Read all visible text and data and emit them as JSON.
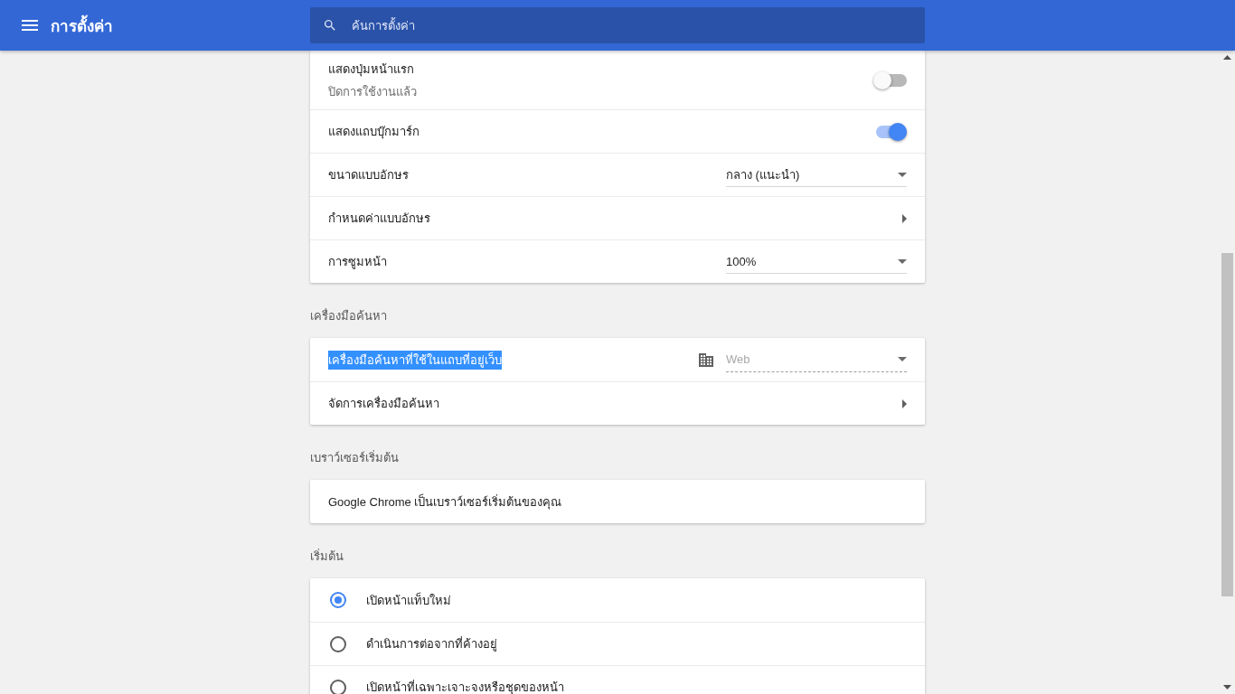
{
  "header": {
    "title": "การตั้งค่า",
    "search": {
      "placeholder": "ค้นการตั้งค่า"
    }
  },
  "sections": [
    {
      "rows": [
        {
          "kind": "toggle",
          "label": "แสดงปุ่มหน้าแรก",
          "sublabel": "ปิดการใช้งานแล้ว",
          "on": false
        },
        {
          "kind": "toggle",
          "label": "แสดงแถบบุ๊กมาร์ก",
          "on": true
        },
        {
          "kind": "select",
          "label": "ขนาดแบบอักษร",
          "value": "กลาง (แนะนำ)",
          "disabled": false
        },
        {
          "kind": "link",
          "label": "กำหนดค่าแบบอักษร"
        },
        {
          "kind": "select",
          "label": "การซูมหน้า",
          "value": "100%",
          "disabled": false
        }
      ]
    },
    {
      "heading": "เครื่องมือค้นหา",
      "rows": [
        {
          "kind": "select",
          "label": "เครื่องมือค้นหาที่ใช้ในแถบที่อยู่เว็บ",
          "highlighted": true,
          "value": "Web",
          "disabled": true
        },
        {
          "kind": "link",
          "label": "จัดการเครื่องมือค้นหา"
        }
      ]
    },
    {
      "heading": "เบราว์เซอร์เริ่มต้น",
      "rows": [
        {
          "kind": "text",
          "label": "Google Chrome เป็นเบราว์เซอร์เริ่มต้นของคุณ"
        }
      ]
    },
    {
      "heading": "เริ่มต้น",
      "rows": [
        {
          "kind": "radio",
          "label": "เปิดหน้าแท็บใหม่",
          "selected": true
        },
        {
          "kind": "radio",
          "label": "ดำเนินการต่อจากที่ค้างอยู่",
          "selected": false
        },
        {
          "kind": "radio",
          "label": "เปิดหน้าที่เฉพาะเจาะจงหรือชุดของหน้า",
          "selected": false
        }
      ]
    }
  ]
}
